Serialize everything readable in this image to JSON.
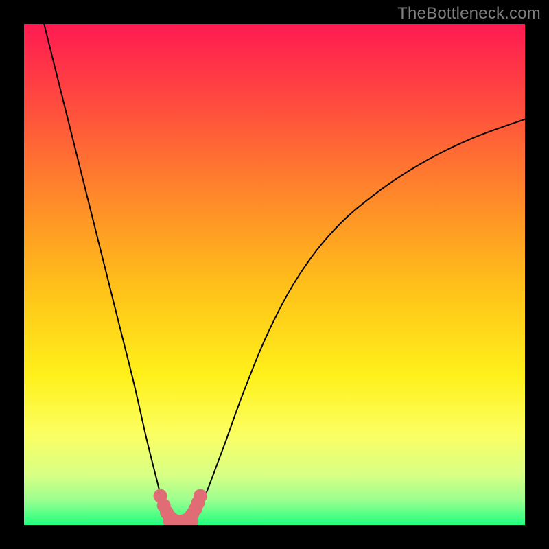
{
  "attribution": "TheBottleneck.com",
  "chart_data": {
    "type": "line",
    "title": "",
    "xlabel": "",
    "ylabel": "",
    "xlim": [
      0,
      100
    ],
    "ylim": [
      0,
      100
    ],
    "grid": false,
    "legend": false,
    "background": {
      "type": "vertical-gradient",
      "stops": [
        {
          "pos": 0.0,
          "color": "#ff1a52"
        },
        {
          "pos": 0.17,
          "color": "#ff4f3d"
        },
        {
          "pos": 0.35,
          "color": "#ff8a29"
        },
        {
          "pos": 0.53,
          "color": "#ffc219"
        },
        {
          "pos": 0.7,
          "color": "#fff01a"
        },
        {
          "pos": 0.82,
          "color": "#fbff62"
        },
        {
          "pos": 0.9,
          "color": "#d8ff85"
        },
        {
          "pos": 0.95,
          "color": "#9cff8f"
        },
        {
          "pos": 1.0,
          "color": "#1fff7f"
        }
      ]
    },
    "series": [
      {
        "name": "curve-left",
        "color": "#000000",
        "width": 2,
        "x": [
          4,
          7,
          10,
          13,
          16,
          19,
          22,
          24.5,
          26.5,
          28,
          29
        ],
        "y": [
          100,
          88,
          76,
          64,
          52,
          40,
          28,
          17,
          9,
          3,
          0.5
        ]
      },
      {
        "name": "curve-right",
        "color": "#000000",
        "width": 2,
        "x": [
          33.5,
          35,
          37,
          40,
          44,
          49,
          55,
          62,
          70,
          79,
          89,
          100
        ],
        "y": [
          0.5,
          3,
          8,
          16,
          27,
          39,
          50,
          59,
          66,
          72,
          77,
          81
        ]
      },
      {
        "name": "highlight",
        "type": "scatter",
        "color": "#e06c75",
        "radius": 10,
        "x": [
          27.2,
          27.9,
          28.5,
          29.1,
          29.8,
          30.6,
          31.4,
          32.2,
          33.0,
          33.6,
          34.2,
          34.7,
          35.2
        ],
        "y": [
          5.8,
          3.9,
          2.5,
          1.6,
          1.0,
          0.7,
          0.7,
          0.9,
          1.4,
          2.2,
          3.2,
          4.4,
          5.8
        ]
      },
      {
        "name": "valley-floor",
        "color": "#e06c75",
        "width": 18,
        "x": [
          29.0,
          33.5
        ],
        "y": [
          0.7,
          0.7
        ]
      }
    ]
  }
}
